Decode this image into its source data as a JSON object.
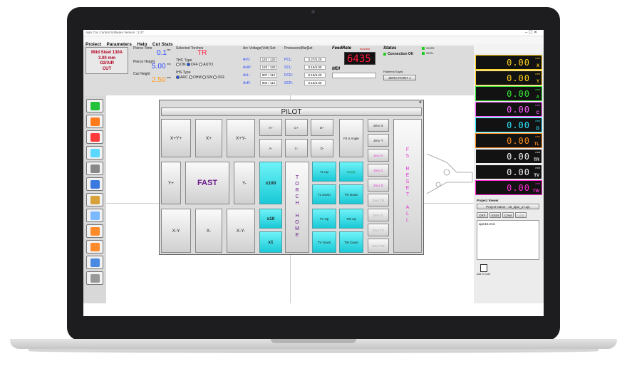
{
  "window": {
    "title": "Ajan Cnc Control Software Version : 2.27"
  },
  "menu": [
    "Project",
    "Parameters",
    "Help",
    "Cut Stats"
  ],
  "material": {
    "line1": "Mild Steel 130A",
    "line2": "3.00 mm",
    "line3": "O2/AIR",
    "line4": "CUT"
  },
  "pierce": {
    "time_label": "Pierce Time",
    "time_value": "0.1",
    "time_unit": "sec",
    "height_label": "Pierce Height",
    "height_value": "5.00",
    "height_unit": "mm",
    "cut_height_label": "Cut Height",
    "cut_height_value": "2.50",
    "cut_height_unit": "mm"
  },
  "torches": {
    "label": "Selected Torches",
    "value": "TR",
    "thc_label": "THC Type",
    "thc_options": [
      "ON",
      "OFF",
      "AUTO"
    ],
    "ihs_label": "IHS Type",
    "ihs_options": [
      "ARC",
      "OHM",
      "SW",
      "OFF"
    ]
  },
  "arc": {
    "label": "Arc Voltage(Volt)",
    "set_label": "Set",
    "rows": [
      {
        "name": "AvV:",
        "value": "120 / 120"
      },
      {
        "name": "AvW:",
        "value": "120 / 120"
      },
      {
        "name": "AvL:",
        "value": "007 / 112"
      },
      {
        "name": "AvR:",
        "value": "004 / 112"
      }
    ]
  },
  "pressures": {
    "label": "Pressures(Bar)",
    "set_label": "Set",
    "rows": [
      {
        "name": "PCL:",
        "value": "0.27/4.20"
      },
      {
        "name": "SCL:",
        "value": "0.15/4.00"
      },
      {
        "name": "PCR:",
        "value": "0.15/4.20"
      },
      {
        "name": "SCR:",
        "value": "0.15/4.00"
      }
    ]
  },
  "feedrate": {
    "label": "FeedRate",
    "unit": "mm/min",
    "value": "6435",
    "mdi_label": "MDI"
  },
  "status": {
    "label": "Status",
    "value": "Connection OK",
    "parking_label": "Paketma Sayisi",
    "zero_point": "ZERO POINT 1",
    "indicators": [
      "OKSR",
      "OKSL"
    ]
  },
  "axes": [
    {
      "name": "X",
      "value": "0.00",
      "unit": "mm",
      "color": "#ffd21a",
      "border": "#ffd21a"
    },
    {
      "name": "Y",
      "value": "0.00",
      "unit": "mm",
      "color": "#ffd21a",
      "border": "#ffd21a"
    },
    {
      "name": "A",
      "value": "0.00",
      "unit": "mm",
      "color": "#35e535",
      "border": "#35e535"
    },
    {
      "name": "C",
      "value": "0.00",
      "unit": "mm",
      "color": "#ff5aff",
      "border": "#ff5aff"
    },
    {
      "name": "D",
      "value": "0.00",
      "unit": "mm",
      "color": "#2ee8ff",
      "border": "#2ee8ff"
    },
    {
      "name": "TL",
      "value": "0.00",
      "unit": "mm",
      "color": "#ff8a1a",
      "border": "#ff8a1a"
    },
    {
      "name": "TR",
      "value": "0.00",
      "unit": "mm",
      "color": "#f0f0f0",
      "border": "#f0f0f0"
    },
    {
      "name": "TV",
      "value": "0.00",
      "unit": "mm",
      "color": "#f0f0f0",
      "border": "#f0f0f0"
    },
    {
      "name": "TW",
      "value": "0.00",
      "unit": "mm",
      "color": "#ff2ad4",
      "border": "#ff2ad4"
    }
  ],
  "project": {
    "viewer_label": "Project Viewer",
    "project_name": "Project Name : 16_ajan_17.ajc",
    "buttons": [
      "DXF",
      "ESSI",
      "CAM",
      "USB"
    ],
    "file": "ajan15.essi",
    "add_code": "Add G Code"
  },
  "pilot": {
    "title": "PILOT",
    "close": "×",
    "jog": [
      "X+Y+",
      "X+",
      "X+Y-",
      "Y+",
      "FAST",
      "Y-",
      "X-Y",
      "X-",
      "X-Y-"
    ],
    "step": [
      "x100",
      "x10",
      "x1"
    ],
    "small": [
      "A+",
      "C+",
      "D+",
      "A-",
      "C-",
      "D-"
    ],
    "fit_angle": "Fit X Angle",
    "torch_home": "TORCH HOME",
    "torch_buttons": [
      "TL Up",
      "Single",
      "TL Down",
      "TR Down",
      "TV Up",
      "TW Up",
      "TV Down",
      "TW Down"
    ],
    "zero": [
      "Zero X",
      "Zero Y",
      "Zero A",
      "Zero C",
      "Zero D",
      "Zero TR",
      "Zero TL",
      "Zero TV",
      "Zero TW"
    ],
    "reset": "F5 RESET ALL"
  }
}
